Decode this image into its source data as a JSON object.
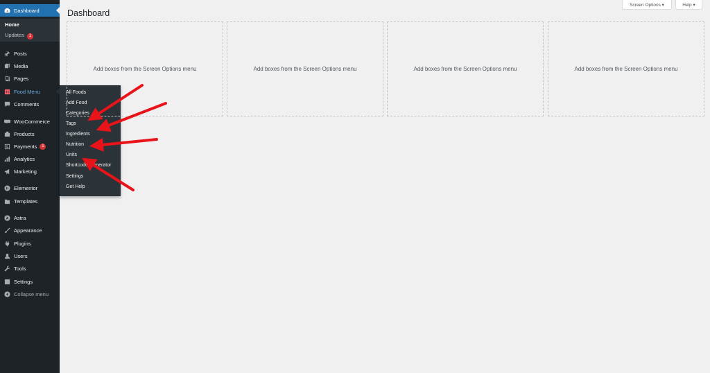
{
  "sidebar": {
    "dashboard": "Dashboard",
    "home": "Home",
    "updates": "Updates",
    "updates_count": "1",
    "posts": "Posts",
    "media": "Media",
    "pages": "Pages",
    "food_menu": "Food Menu",
    "comments": "Comments",
    "woocommerce": "WooCommerce",
    "products": "Products",
    "payments": "Payments",
    "payments_count": "1",
    "analytics": "Analytics",
    "marketing": "Marketing",
    "elementor": "Elementor",
    "templates": "Templates",
    "astra": "Astra",
    "appearance": "Appearance",
    "plugins": "Plugins",
    "users": "Users",
    "tools": "Tools",
    "settings": "Settings",
    "collapse": "Collapse menu"
  },
  "flyout": {
    "items": [
      "All Foods",
      "Add Food",
      "Categories",
      "Tags",
      "Ingredients",
      "Nutrition",
      "Units",
      "Shortcode Generator",
      "Settings",
      "Get Help"
    ]
  },
  "main": {
    "title": "Dashboard",
    "screen_options": "Screen Options ▾",
    "help": "Help ▾",
    "box_text": "Add boxes from the Screen Options menu"
  },
  "colors": {
    "sidebar_bg": "#1d2327",
    "active": "#2271b1",
    "annotation_arrow": "#e8141a"
  }
}
